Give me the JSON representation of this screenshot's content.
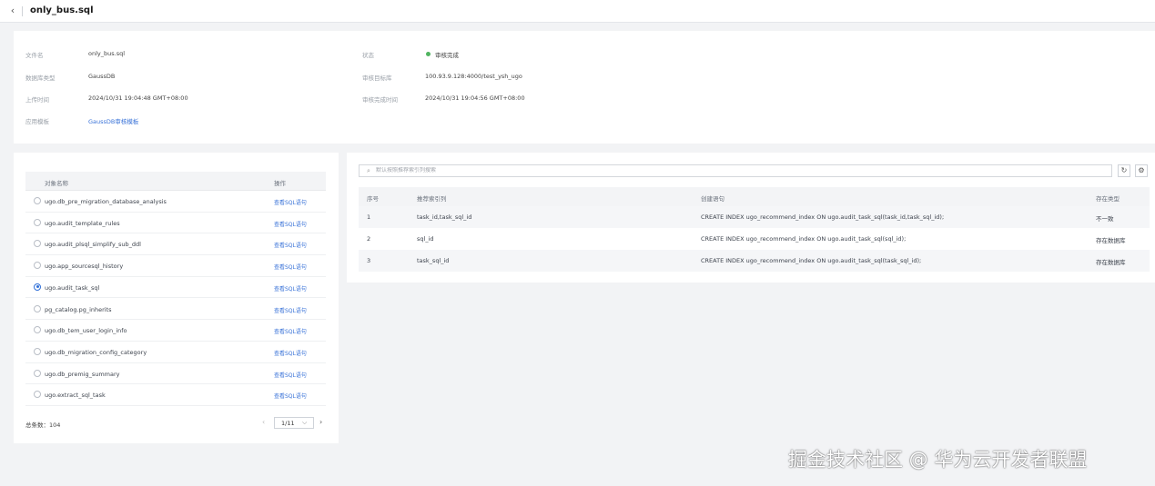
{
  "header": {
    "title": "only_bus.sql",
    "back_icon": "chevron-left-icon"
  },
  "info": {
    "file_name_label": "文件名",
    "file_name": "only_bus.sql",
    "db_type_label": "数据库类型",
    "db_type": "GaussDB",
    "upload_time_label": "上传时间",
    "upload_time": "2024/10/31 19:04:48 GMT+08:00",
    "template_label": "应用模板",
    "template": "GaussDB审核模板",
    "status_label": "状态",
    "status": "审核完成",
    "status_color": "#50b460",
    "target_db_label": "审核目标库",
    "target_db": "100.93.9.128:4000/test_ysh_ugo",
    "finish_time_label": "审核完成时间",
    "finish_time": "2024/10/31 19:04:56 GMT+08:00"
  },
  "objects": {
    "col_name": "对象名称",
    "col_action": "操作",
    "rows": [
      {
        "name": "ugo.db_pre_migration_database_analysis",
        "action": "查看SQL语句",
        "selected": false
      },
      {
        "name": "ugo.audit_template_rules",
        "action": "查看SQL语句",
        "selected": false
      },
      {
        "name": "ugo.audit_plsql_simplify_sub_ddl",
        "action": "查看SQL语句",
        "selected": false
      },
      {
        "name": "ugo.app_sourcesql_history",
        "action": "查看SQL语句",
        "selected": false
      },
      {
        "name": "ugo.audit_task_sql",
        "action": "查看SQL语句",
        "selected": true
      },
      {
        "name": "pg_catalog.pg_inherits",
        "action": "查看SQL语句",
        "selected": false
      },
      {
        "name": "ugo.db_tem_user_login_info",
        "action": "查看SQL语句",
        "selected": false
      },
      {
        "name": "ugo.db_migration_config_category",
        "action": "查看SQL语句",
        "selected": false
      },
      {
        "name": "ugo.db_premig_summary",
        "action": "查看SQL语句",
        "selected": false
      },
      {
        "name": "ugo.extract_sql_task",
        "action": "查看SQL语句",
        "selected": false
      }
    ],
    "total": "总条数：104",
    "page": "1/11"
  },
  "indexes": {
    "search_placeholder": "默认按照推荐索引列搜索",
    "columns": [
      "序号",
      "推荐索引列",
      "创建语句",
      "存在类型"
    ],
    "rows": [
      {
        "no": "1",
        "cols": "task_id,task_sql_id",
        "stmt": "CREATE INDEX ugo_recommend_index ON ugo.audit_task_sql(task_id,task_sql_id);",
        "type": "不一致"
      },
      {
        "no": "2",
        "cols": "sql_id",
        "stmt": "CREATE INDEX ugo_recommend_index ON ugo.audit_task_sql(sql_id);",
        "type": "存在数据库"
      },
      {
        "no": "3",
        "cols": "task_sql_id",
        "stmt": "CREATE INDEX ugo_recommend_index ON ugo.audit_task_sql(task_sql_id);",
        "type": "存在数据库"
      }
    ]
  },
  "watermark": "掘金技术社区 @ 华为云开发者联盟"
}
